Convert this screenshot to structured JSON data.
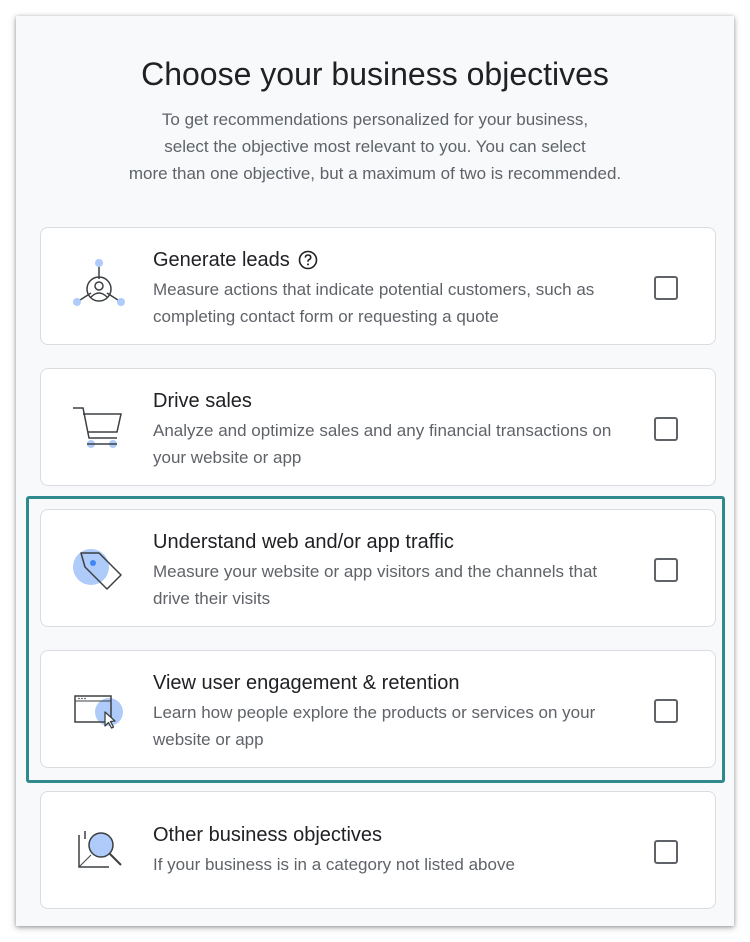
{
  "page": {
    "title": "Choose your business objectives",
    "subtitle": "To get recommendations personalized for your business,\nselect the objective most relevant to you. You can select\nmore than one objective, but a maximum of two is recommended."
  },
  "objectives": [
    {
      "title": "Generate leads",
      "description": "Measure actions that indicate potential customers, such as completing contact form or requesting a quote",
      "icon": "leads-icon",
      "has_help": true,
      "checked": false
    },
    {
      "title": "Drive sales",
      "description": "Analyze and optimize sales and any financial transactions on your website or app",
      "icon": "cart-icon",
      "checked": false
    },
    {
      "title": "Understand web and/or app traffic",
      "description": "Measure your website or app visitors and the channels that drive their visits",
      "icon": "tag-icon",
      "checked": false
    },
    {
      "title": "View user engagement & retention",
      "description": "Learn how people explore the products or services on your website or app",
      "icon": "browser-cursor-icon",
      "checked": false
    },
    {
      "title": "Other business objectives",
      "description": "If your business is in a category not listed above",
      "icon": "magnifier-icon",
      "checked": false
    }
  ],
  "colors": {
    "highlight": "#2e8a8c",
    "icon_accent": "#aecbfa",
    "icon_stroke": "#3c4043"
  }
}
